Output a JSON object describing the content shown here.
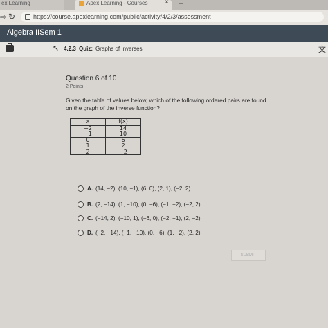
{
  "browser": {
    "tabs": [
      {
        "label": "ex Learning"
      },
      {
        "label": "Apex Learning - Courses",
        "close": "×"
      }
    ],
    "new_tab": "+",
    "url": "https://course.apexlearning.com/public/activity/4/2/3/assessment"
  },
  "app": {
    "title": "Algebra IISem 1"
  },
  "toolbar": {
    "lesson_number": "4.2.3",
    "quiz_label": "Quiz:",
    "lesson_title": "Graphs of Inverses"
  },
  "question": {
    "title": "Question 6 of 10",
    "points": "2 Points",
    "prompt": "Given the table of values below, which of the following ordered pairs are found on the graph of the inverse function?",
    "table": {
      "headers": [
        "x",
        "f(x)"
      ],
      "rows": [
        [
          "−2",
          "14"
        ],
        [
          "−1",
          "10"
        ],
        [
          "0",
          "6"
        ],
        [
          "1",
          "2"
        ],
        [
          "2",
          "−2"
        ]
      ]
    },
    "options": [
      {
        "letter": "A.",
        "text": "(14, −2), (10, −1), (6, 0), (2, 1), (−2, 2)"
      },
      {
        "letter": "B.",
        "text": "(2, −14), (1, −10), (0, −6), (−1, −2), (−2, 2)"
      },
      {
        "letter": "C.",
        "text": "(−14, 2), (−10, 1), (−6, 0), (−2, −1), (2, −2)"
      },
      {
        "letter": "D.",
        "text": "(−2, −14), (−1, −10), (0, −6), (1, −2), (2, 2)"
      }
    ],
    "submit_label": "SUBMIT"
  },
  "icons": {
    "back": "⇨",
    "reload": "↻",
    "up": "↖",
    "lang": "文"
  },
  "colors": {
    "appbar": "#3e4a56",
    "tab_favicon": "#e8a33a"
  }
}
